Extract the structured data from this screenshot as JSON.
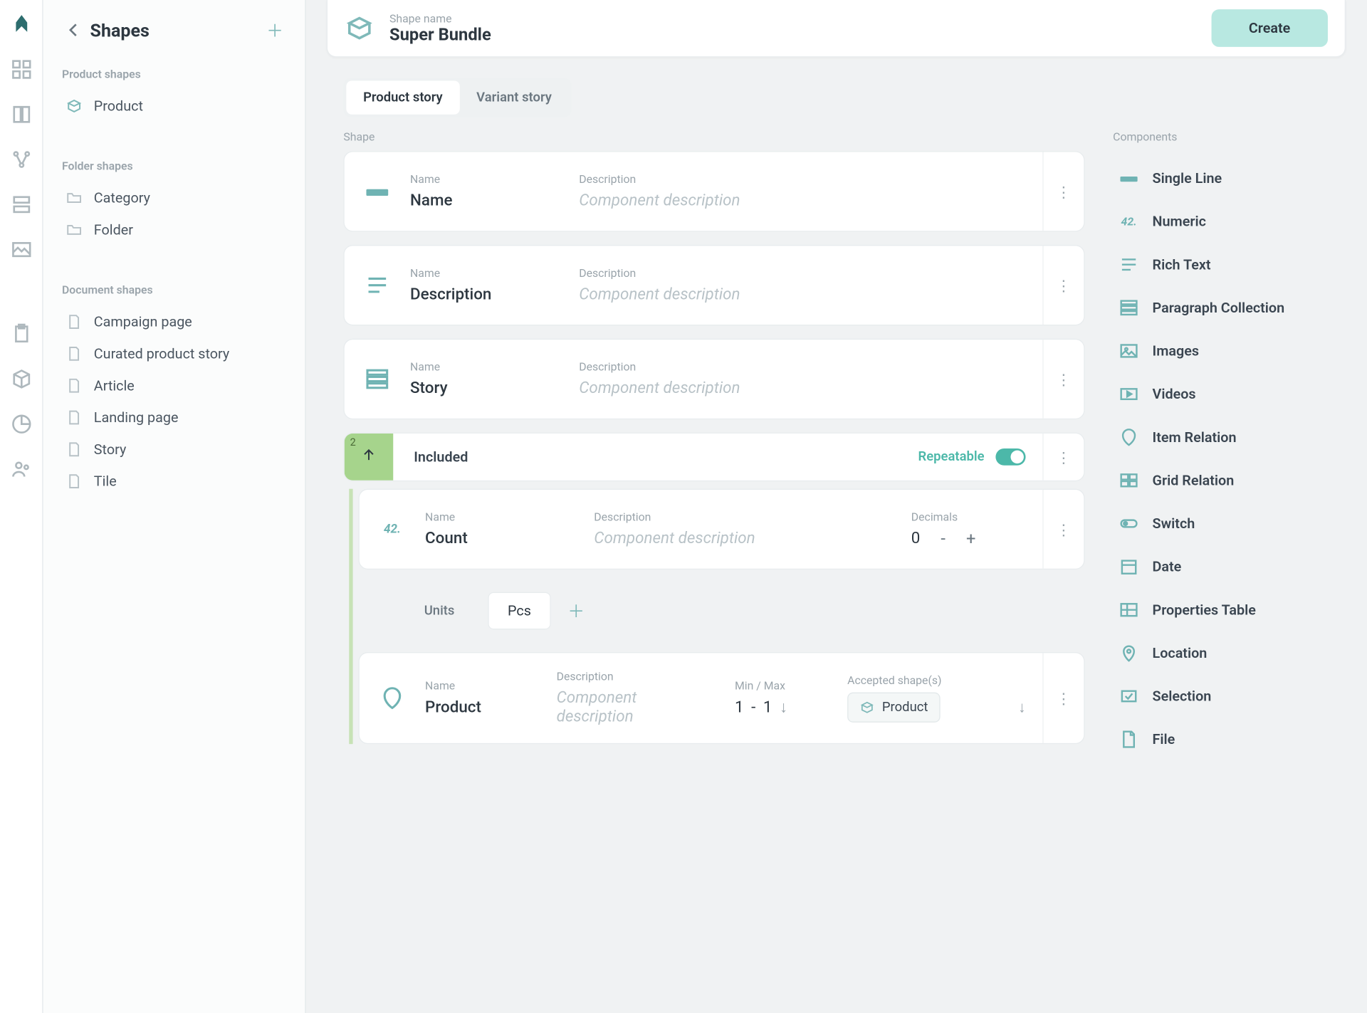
{
  "sidebar": {
    "title": "Shapes",
    "groups": [
      {
        "label": "Product shapes",
        "items": [
          {
            "name": "Product",
            "icon": "product"
          }
        ]
      },
      {
        "label": "Folder shapes",
        "items": [
          {
            "name": "Category",
            "icon": "folder"
          },
          {
            "name": "Folder",
            "icon": "folder"
          }
        ]
      },
      {
        "label": "Document shapes",
        "items": [
          {
            "name": "Campaign page",
            "icon": "doc"
          },
          {
            "name": "Curated product story",
            "icon": "doc"
          },
          {
            "name": "Article",
            "icon": "doc"
          },
          {
            "name": "Landing page",
            "icon": "doc"
          },
          {
            "name": "Story",
            "icon": "doc"
          },
          {
            "name": "Tile",
            "icon": "doc"
          }
        ]
      }
    ]
  },
  "header": {
    "field_label": "Shape name",
    "shape_name": "Super Bundle",
    "create_label": "Create"
  },
  "tabs": {
    "active": "Product story",
    "other": "Variant story"
  },
  "shape_section_label": "Shape",
  "labels": {
    "name": "Name",
    "description": "Description",
    "desc_placeholder": "Component description",
    "decimals": "Decimals",
    "units": "Units",
    "minmax": "Min / Max",
    "accepted": "Accepted shape(s)"
  },
  "components": {
    "name": {
      "name": "Name"
    },
    "description": {
      "name": "Description"
    },
    "story": {
      "name": "Story"
    },
    "included": {
      "title": "Included",
      "count_badge": "2",
      "repeatable_label": "Repeatable",
      "count": {
        "name": "Count",
        "decimals": "0"
      },
      "unit_chip": "Pcs",
      "product": {
        "name": "Product",
        "min": "1",
        "max": "1",
        "accepted": "Product"
      }
    }
  },
  "palette_label": "Components",
  "palette": [
    "Single Line",
    "Numeric",
    "Rich Text",
    "Paragraph Collection",
    "Images",
    "Videos",
    "Item Relation",
    "Grid Relation",
    "Switch",
    "Date",
    "Properties Table",
    "Location",
    "Selection",
    "File"
  ]
}
